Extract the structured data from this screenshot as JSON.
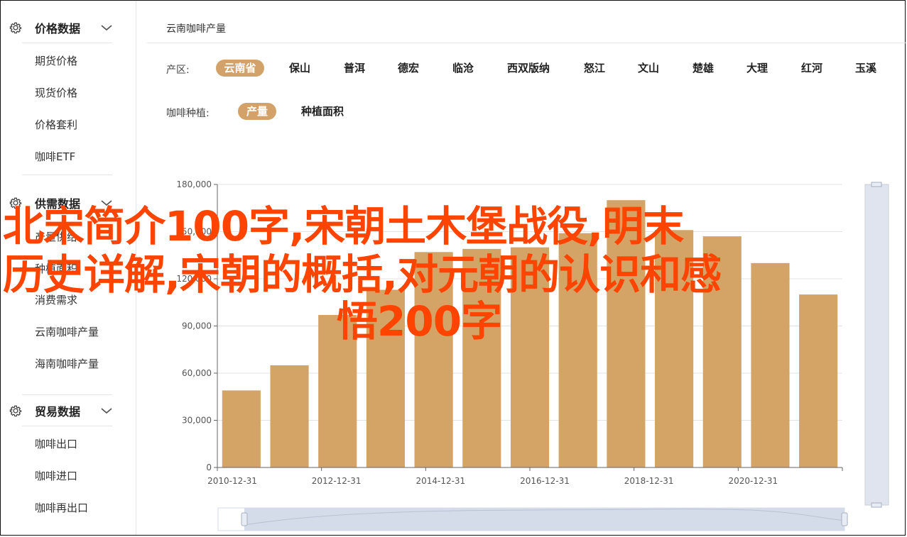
{
  "sidebar": {
    "sections": [
      {
        "title": "价格数据",
        "items": [
          "期货价格",
          "现货价格",
          "价格套利",
          "咖啡ETF"
        ]
      },
      {
        "title": "供需数据",
        "items": [
          "产量供给",
          "种植面积",
          "消费需求",
          "云南咖啡产量",
          "海南咖啡产量"
        ]
      },
      {
        "title": "贸易数据",
        "items": [
          "咖啡出口",
          "咖啡进口",
          "咖啡再出口"
        ]
      }
    ]
  },
  "main": {
    "title": "云南咖啡产量",
    "region_label": "产区:",
    "regions": [
      "云南省",
      "保山",
      "普洱",
      "德宏",
      "临沧",
      "西双版纳",
      "怒江",
      "文山",
      "楚雄",
      "大理",
      "红河",
      "玉溪"
    ],
    "region_selected": "云南省",
    "metric_label": "咖啡种植:",
    "metrics": [
      "产量",
      "种植面积"
    ],
    "metric_selected": "产量"
  },
  "chart_data": {
    "type": "bar",
    "x_labels_shown": [
      "2010-12-31",
      "2012-12-31",
      "2014-12-31",
      "2016-12-31",
      "2018-12-31",
      "2020-12-31"
    ],
    "values": [
      49000,
      65000,
      97000,
      113000,
      137000,
      139000,
      140000,
      149000,
      170000,
      151000,
      147000,
      130000,
      110000
    ],
    "ylim": [
      0,
      180000
    ],
    "y_ticks": [
      "0",
      "30,000",
      "60,000",
      "90,000",
      "120,000",
      "150,000",
      "180,000"
    ],
    "bar_color": "#d4a366",
    "grid": true
  },
  "overlay": {
    "lines": [
      "北宋简介100字,宋朝土木堡战役,明末",
      "历史详解,宋朝的概括,对元朝的认识和感",
      "悟200字"
    ],
    "color": "#ff4400"
  }
}
